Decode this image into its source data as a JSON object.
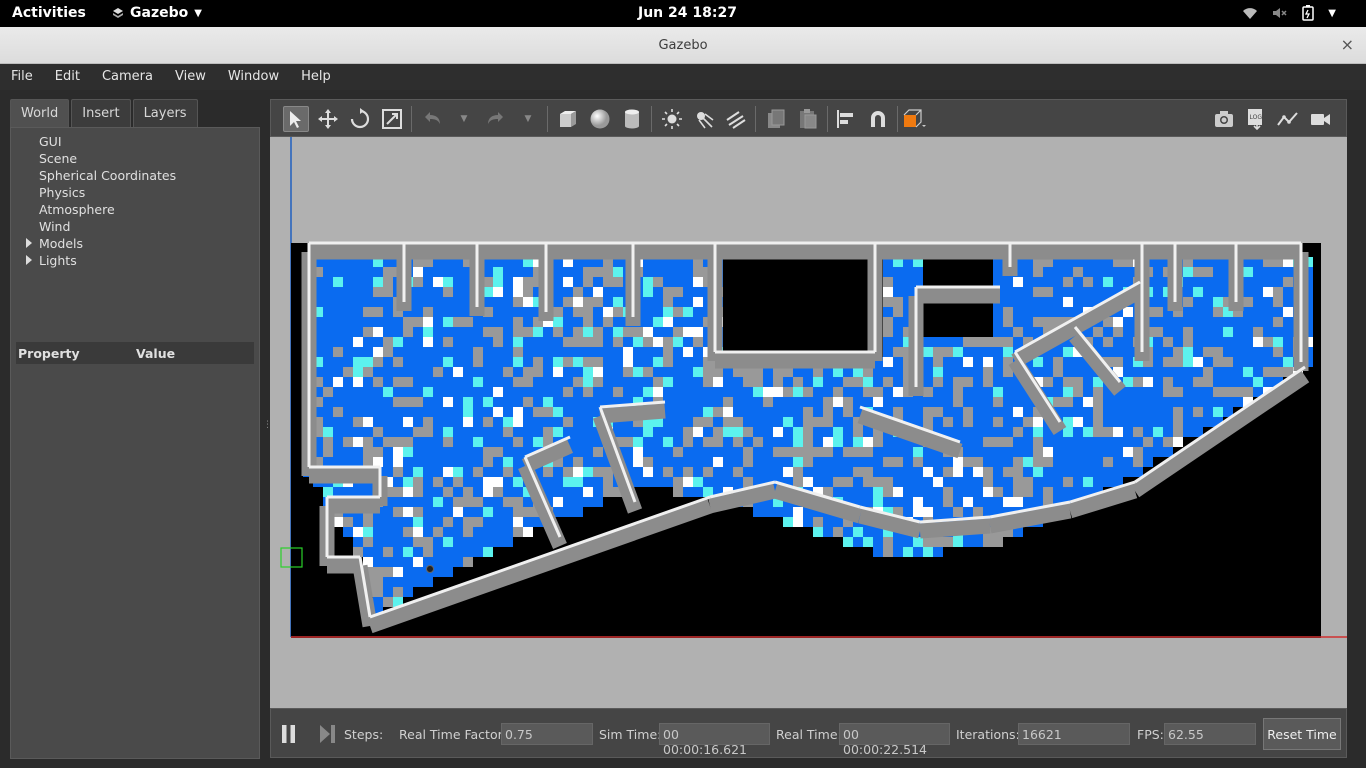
{
  "topbar": {
    "activities": "Activities",
    "app": "Gazebo",
    "clock": "Jun 24  18:27"
  },
  "window": {
    "title": "Gazebo",
    "close": "×"
  },
  "menu": [
    "File",
    "Edit",
    "Camera",
    "View",
    "Window",
    "Help"
  ],
  "left": {
    "tabs": [
      "World",
      "Insert",
      "Layers"
    ],
    "tree": [
      "GUI",
      "Scene",
      "Spherical Coordinates",
      "Physics",
      "Atmosphere",
      "Wind",
      "Models",
      "Lights"
    ],
    "prop_header": {
      "property": "Property",
      "value": "Value"
    }
  },
  "status": {
    "steps": "Steps:",
    "rtf_label": "Real Time Factor:",
    "rtf": "0.75",
    "sim_label": "Sim Time:",
    "sim": "00 00:00:16.621",
    "real_label": "Real Time:",
    "real": "00 00:00:22.514",
    "iter_label": "Iterations:",
    "iter": "16621",
    "fps_label": "FPS:",
    "fps": "62.55",
    "reset": "Reset Time"
  },
  "icons": [
    "select-icon",
    "translate-icon",
    "rotate-icon",
    "scale-icon",
    "undo-icon",
    "redo-icon",
    "box-icon",
    "sphere-icon",
    "cylinder-icon",
    "point-light-icon",
    "spot-light-icon",
    "directional-light-icon",
    "copy-icon",
    "paste-icon",
    "align-icon",
    "snap-icon",
    "view-angle-icon",
    "screenshot-icon",
    "log-icon",
    "plot-icon",
    "video-icon"
  ],
  "colors": {
    "map_blue": "#0a6bf0",
    "map_cyan": "#5cf2ee",
    "map_grey": "#999999",
    "wall": "#8c8c8c"
  }
}
